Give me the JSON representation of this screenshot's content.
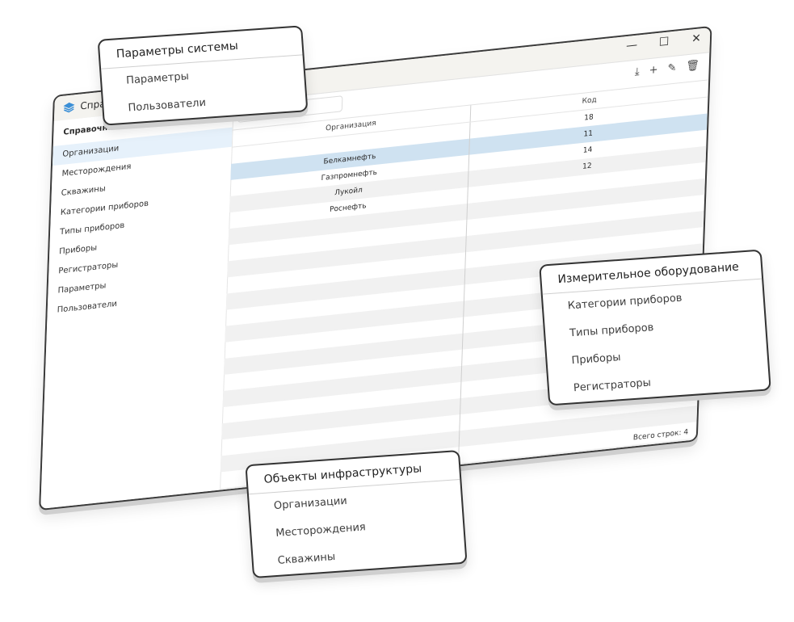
{
  "window": {
    "app_title": "Справочник",
    "controls": {
      "minimize": "—",
      "maximize": "☐",
      "close": "✕"
    }
  },
  "sidebar": {
    "header": "Справочник",
    "items": [
      {
        "label": "Организации",
        "active": true
      },
      {
        "label": "Месторождения"
      },
      {
        "label": "Скважины"
      },
      {
        "label": "Категории приборов"
      },
      {
        "label": "Типы приборов"
      },
      {
        "label": "Приборы"
      },
      {
        "label": "Регистраторы"
      },
      {
        "label": "Параметры"
      },
      {
        "label": "Пользователи"
      }
    ]
  },
  "toolbar": {
    "search_placeholder": "Поиск",
    "icons": [
      "download-icon",
      "add-icon",
      "edit-icon",
      "delete-icon"
    ],
    "icon_glyphs": {
      "download": "⤓",
      "add": "+",
      "edit": "✎",
      "delete": "🗑"
    }
  },
  "table": {
    "columns": [
      "Организация",
      "Код"
    ],
    "rows": [
      {
        "org": "",
        "code": "18"
      },
      {
        "org": "Белкамнефть",
        "code": "11",
        "selected": true
      },
      {
        "org": "Газпромнефть",
        "code": "14"
      },
      {
        "org": "Лукойл",
        "code": "12"
      },
      {
        "org": "Роснефть",
        "code": ""
      }
    ],
    "status": "Всего строк: 4"
  },
  "cards": {
    "system": {
      "title": "Параметры системы",
      "items": [
        "Параметры",
        "Пользователи"
      ]
    },
    "measurement": {
      "title": "Измерительное оборудование",
      "items": [
        "Категории приборов",
        "Типы приборов",
        "Приборы",
        "Регистраторы"
      ]
    },
    "infrastructure": {
      "title": "Объекты инфраструктуры",
      "items": [
        "Организации",
        "Месторождения",
        "Скважины"
      ]
    }
  },
  "colors": {
    "accent": "#cfe2f1",
    "active_sidebar": "#e6f1fb",
    "stack_icon": "#3b8fd6"
  }
}
